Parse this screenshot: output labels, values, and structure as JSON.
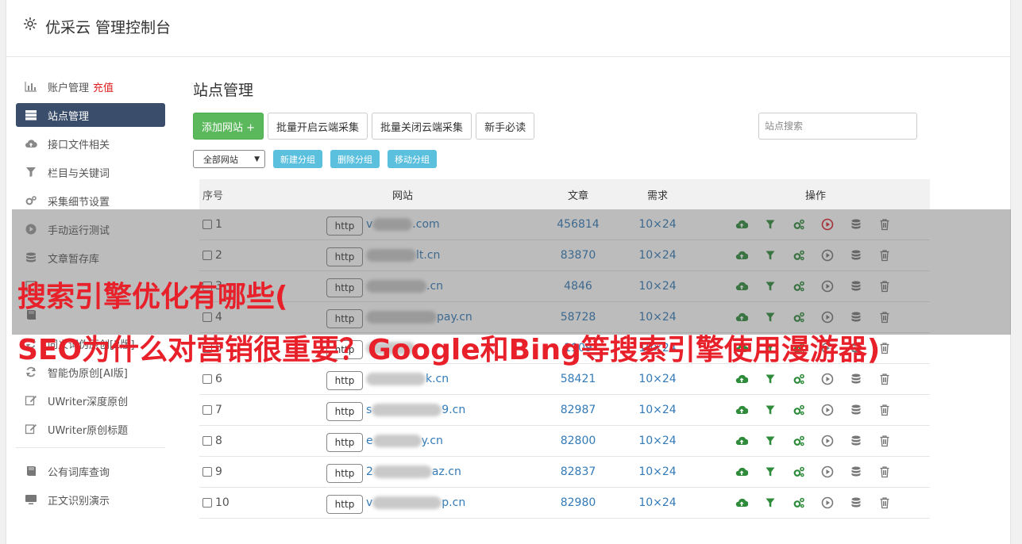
{
  "header": {
    "title": "优采云 管理控制台",
    "icon": "gear-icon"
  },
  "sidebar": {
    "items": [
      {
        "label": "账户管理",
        "extra": "充值",
        "icon": "bar-chart-icon",
        "active": false
      },
      {
        "label": "站点管理",
        "icon": "server-icon",
        "active": true
      },
      {
        "label": "接口文件相关",
        "icon": "cloud-upload-icon",
        "active": false
      },
      {
        "label": "栏目与关键词",
        "icon": "filter-icon",
        "active": false
      },
      {
        "label": "采集细节设置",
        "icon": "cogs-icon",
        "active": false
      },
      {
        "label": "手动运行测试",
        "icon": "play-icon",
        "active": false
      },
      {
        "label": "文章暂存库",
        "icon": "database-icon",
        "active": false
      },
      {
        "label": "",
        "icon": "task-icon",
        "active": false
      },
      {
        "label": "",
        "icon": "book-icon",
        "active": false
      },
      {
        "label": "同义词伪原创[2版]",
        "icon": "refresh-icon",
        "active": false
      },
      {
        "label": "智能伪原创[AI版]",
        "icon": "refresh-icon",
        "active": false
      },
      {
        "label": "UWriter深度原创",
        "icon": "edit-icon",
        "active": false
      },
      {
        "label": "UWriter原创标题",
        "icon": "edit-icon",
        "active": false
      }
    ],
    "bottom_items": [
      {
        "label": "公有词库查询",
        "icon": "book-icon"
      },
      {
        "label": "正文识别演示",
        "icon": "monitor-icon"
      }
    ]
  },
  "main": {
    "title": "站点管理",
    "toolbar": {
      "add_site": "添加网站 +",
      "batch_open": "批量开启云端采集",
      "batch_close": "批量关闭云端采集",
      "newbie": "新手必读"
    },
    "search": {
      "placeholder": "站点搜索"
    },
    "group_select": "全部网站",
    "group_buttons": {
      "new_group": "新建分组",
      "delete_group": "删除分组",
      "move_group": "移动分组"
    },
    "table": {
      "headers": {
        "no": "序号",
        "site": "网站",
        "articles": "文章",
        "demand": "需求",
        "ops": "操作"
      },
      "http_label": "http",
      "rows": [
        {
          "no": "1",
          "site_prefix": "v",
          "site_suffix": ".com",
          "articles": "456814",
          "demand": "10×24",
          "play_active": true
        },
        {
          "no": "2",
          "site_prefix": "",
          "site_suffix": "lt.cn",
          "articles": "83870",
          "demand": "10×24",
          "play_active": false
        },
        {
          "no": "3",
          "site_prefix": "",
          "site_suffix": ".cn",
          "articles": "4846",
          "demand": "10×24",
          "play_active": false
        },
        {
          "no": "4",
          "site_prefix": "",
          "site_suffix": "pay.cn",
          "articles": "58728",
          "demand": "10×24",
          "play_active": false
        },
        {
          "no": "5",
          "site_prefix": "",
          "site_suffix": "",
          "articles": "1909",
          "demand": "10×24",
          "play_active": false
        },
        {
          "no": "6",
          "site_prefix": "",
          "site_suffix": "k.cn",
          "articles": "58421",
          "demand": "10×24",
          "play_active": false
        },
        {
          "no": "7",
          "site_prefix": "s",
          "site_suffix": "9.cn",
          "articles": "82987",
          "demand": "10×24",
          "play_active": false
        },
        {
          "no": "8",
          "site_prefix": "e",
          "site_suffix": "y.cn",
          "articles": "82800",
          "demand": "10×24",
          "play_active": false
        },
        {
          "no": "9",
          "site_prefix": "2",
          "site_suffix": "az.cn",
          "articles": "82837",
          "demand": "10×24",
          "play_active": false
        },
        {
          "no": "10",
          "site_prefix": "v",
          "site_suffix": "p.cn",
          "articles": "82980",
          "demand": "10×24",
          "play_active": false
        }
      ]
    }
  },
  "overlay": {
    "line1": "搜索引擎优化有哪些(",
    "line2": "SEO为什么对营销很重要？Google和Bing等搜索引擎使用漫游器)"
  },
  "colors": {
    "accent_green": "#5cb85c",
    "info_blue": "#5bc0de",
    "nav_active": "#3a4e6b",
    "link_blue": "#337ab7",
    "overlay_red": "#e8202a"
  }
}
